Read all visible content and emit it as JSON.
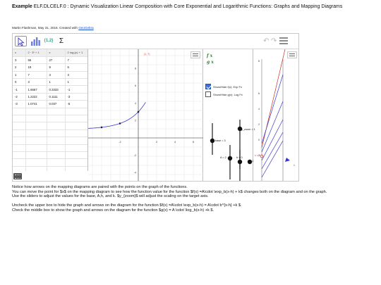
{
  "header": {
    "title_prefix": "Example",
    "title_rest": "ELF.DLCELF.0 : Dynamic Visualization Linear Composition with Core Exponential and Logarithmic Functions: Graphs and Mapping Diagrams",
    "credit_text": "Martin Flashman, May 31, 2016. Created with",
    "credit_link": "GeoGebra"
  },
  "toolbar": {
    "list_label": "{1,2}",
    "sum_label": "Σ",
    "undo_label": "↶",
    "redo_label": "↷"
  },
  "spreadsheet": {
    "columns": [
      "x",
      "2 · 3ˣ + 1",
      "x",
      "2 log₃(x) + 1"
    ],
    "rows": [
      [
        "3",
        "55",
        "27",
        "7"
      ],
      [
        "2",
        "19",
        "9",
        "5"
      ],
      [
        "1",
        "7",
        "3",
        "3"
      ],
      [
        "0",
        "3",
        "1",
        "1"
      ],
      [
        "-1",
        "1.6667",
        "0.3333",
        "-1"
      ],
      [
        "-2",
        "1.2222",
        "0.1111",
        "-3"
      ],
      [
        "-3",
        "1.0741",
        "0.037",
        "-5"
      ],
      [
        "",
        "",
        "",
        ""
      ],
      [
        "",
        "",
        "",
        ""
      ],
      [
        "",
        "",
        "",
        ""
      ],
      [
        "",
        "",
        "",
        ""
      ],
      [
        "",
        "",
        "",
        ""
      ],
      [
        "",
        "",
        "",
        ""
      ],
      [
        "",
        "",
        "",
        ""
      ],
      [
        "",
        "",
        "",
        ""
      ],
      [
        "",
        "",
        "",
        ""
      ]
    ]
  },
  "graph": {
    "x_ticks": [
      "-2",
      "2",
      "4",
      "6"
    ],
    "y_ticks": [
      "8",
      "6",
      "4",
      "2",
      "-2",
      "-4"
    ],
    "point_label": "(1, 7)",
    "colors": {
      "curve": "#3b3bd6",
      "axis": "#333333",
      "grid": "#e2e2e2",
      "point": "#cc4422"
    }
  },
  "controls": {
    "f_label": "f x",
    "g_label": "g x",
    "checkbox_exp": {
      "label": "Show/Hide f(x): Exp Fx",
      "checked": true
    },
    "checkbox_log": {
      "label": "Show/Hide g(x): Log Fx",
      "checked": false
    },
    "slider_base": "base = 3",
    "slider_zoom": "y_zoom = 1",
    "slider_A": "A = 2",
    "slider_h": "h = 0",
    "slider_k": "k = 1"
  },
  "mapping": {
    "top_label": "8",
    "mid_labels": [
      "6",
      "4",
      "2",
      "0",
      "-2"
    ],
    "value_label": "x = 2",
    "right_label": "1",
    "colors": {
      "arrows": "#3535d0",
      "red_line": "#cc3322",
      "marker": "#cc3322"
    }
  },
  "instructions": {
    "p1": "Notice how arrows on the mapping diagrams are paired with the points on the graph of the functions.",
    "p2": "You can move the point for $x$ on the mapping diagram to see how the function value for the function $f(x) =A\\cdot \\exp_b(x-h) + k$ changes both on the diagram and on the graph.",
    "p3": "Use the sliders to adjust the values for the base, A,h, and k.  $y_{zoom}$ will adjust the scaling on the target axis.",
    "p4": "Uncheck the upper box to hide the graph and arrows on the diagram for the function $f(x) =A\\cdot \\exp_b(x-h)  = A\\cdot b^{x-h} +k $.",
    "p5": "Check the middle box to show the graph and arrows on the diagram for the function $g(x) = A \\cdot \\log_b(x-h) +k $."
  }
}
